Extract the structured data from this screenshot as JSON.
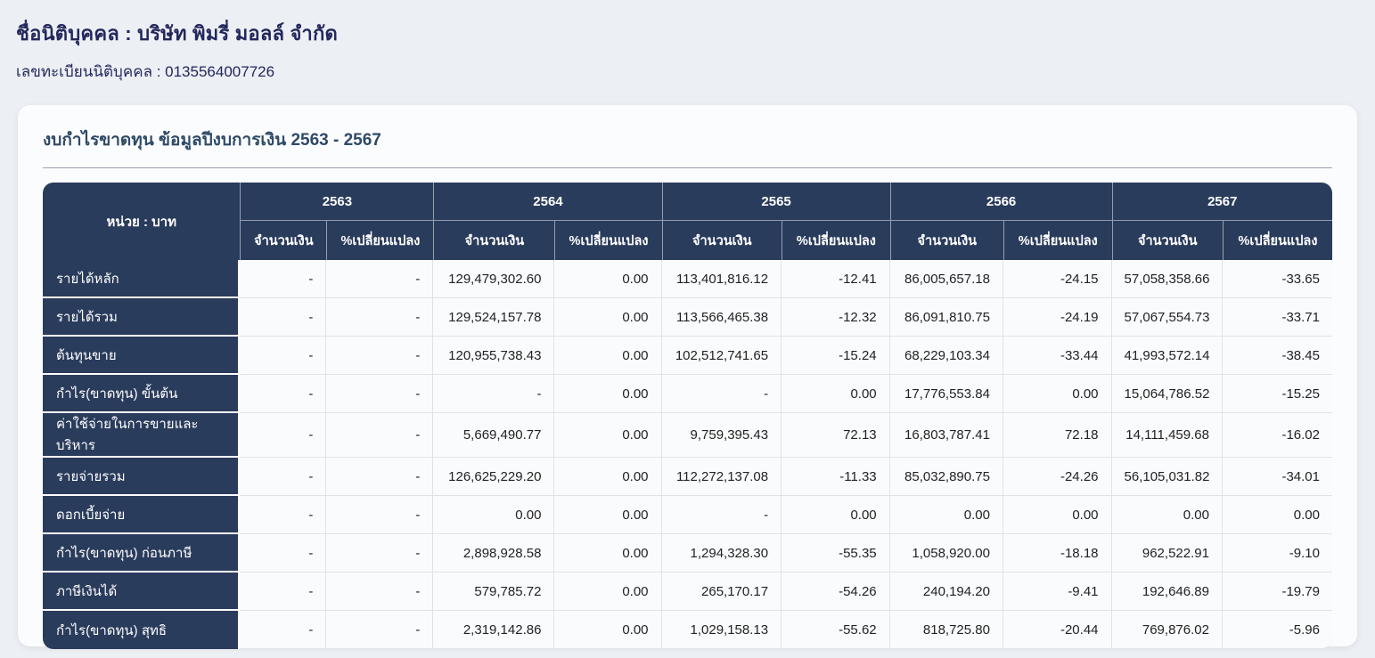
{
  "page": {
    "company_label": "ชื่อนิติบุคคล : บริษัท พิมรี่ มอลล์ จำกัด",
    "registration_label": "เลขทะเบียนนิติบุคคล : 0135564007726"
  },
  "card": {
    "title": "งบกำไรขาดทุน ข้อมูลปีงบการเงิน 2563 - 2567"
  },
  "table": {
    "unit_header": "หน่วย : บาท",
    "years": [
      "2563",
      "2564",
      "2565",
      "2566",
      "2567"
    ],
    "amount_header": "จำนวนเงิน",
    "change_header": "%เปลี่ยนแปลง",
    "rows": [
      {
        "label": "รายได้หลัก",
        "values": [
          "-",
          "-",
          "129,479,302.60",
          "0.00",
          "113,401,816.12",
          "-12.41",
          "86,005,657.18",
          "-24.15",
          "57,058,358.66",
          "-33.65"
        ]
      },
      {
        "label": "รายได้รวม",
        "values": [
          "-",
          "-",
          "129,524,157.78",
          "0.00",
          "113,566,465.38",
          "-12.32",
          "86,091,810.75",
          "-24.19",
          "57,067,554.73",
          "-33.71"
        ]
      },
      {
        "label": "ต้นทุนขาย",
        "values": [
          "-",
          "-",
          "120,955,738.43",
          "0.00",
          "102,512,741.65",
          "-15.24",
          "68,229,103.34",
          "-33.44",
          "41,993,572.14",
          "-38.45"
        ]
      },
      {
        "label": "กำไร(ขาดทุน) ขั้นต้น",
        "values": [
          "-",
          "-",
          "-",
          "0.00",
          "-",
          "0.00",
          "17,776,553.84",
          "0.00",
          "15,064,786.52",
          "-15.25"
        ]
      },
      {
        "label": "ค่าใช้จ่ายในการขายและบริหาร",
        "values": [
          "-",
          "-",
          "5,669,490.77",
          "0.00",
          "9,759,395.43",
          "72.13",
          "16,803,787.41",
          "72.18",
          "14,111,459.68",
          "-16.02"
        ]
      },
      {
        "label": "รายจ่ายรวม",
        "values": [
          "-",
          "-",
          "126,625,229.20",
          "0.00",
          "112,272,137.08",
          "-11.33",
          "85,032,890.75",
          "-24.26",
          "56,105,031.82",
          "-34.01"
        ]
      },
      {
        "label": "ดอกเบี้ยจ่าย",
        "values": [
          "-",
          "-",
          "0.00",
          "0.00",
          "-",
          "0.00",
          "0.00",
          "0.00",
          "0.00",
          "0.00"
        ]
      },
      {
        "label": "กำไร(ขาดทุน) ก่อนภาษี",
        "values": [
          "-",
          "-",
          "2,898,928.58",
          "0.00",
          "1,294,328.30",
          "-55.35",
          "1,058,920.00",
          "-18.18",
          "962,522.91",
          "-9.10"
        ]
      },
      {
        "label": "ภาษีเงินได้",
        "values": [
          "-",
          "-",
          "579,785.72",
          "0.00",
          "265,170.17",
          "-54.26",
          "240,194.20",
          "-9.41",
          "192,646.89",
          "-19.79"
        ]
      },
      {
        "label": "กำไร(ขาดทุน) สุทธิ",
        "values": [
          "-",
          "-",
          "2,319,142.86",
          "0.00",
          "1,029,158.13",
          "-55.62",
          "818,725.80",
          "-20.44",
          "769,876.02",
          "-5.96"
        ]
      }
    ]
  },
  "theme": {
    "page_bg": "#eceff3",
    "card_bg": "#fbfcfe",
    "navy": "#2a3c5c",
    "heading_text": "#23275c",
    "title_text": "#2f4a66",
    "cell_bg": "#fafbfd",
    "grid_line": "#dfe3e8",
    "rule_line": "#97a3b1"
  }
}
